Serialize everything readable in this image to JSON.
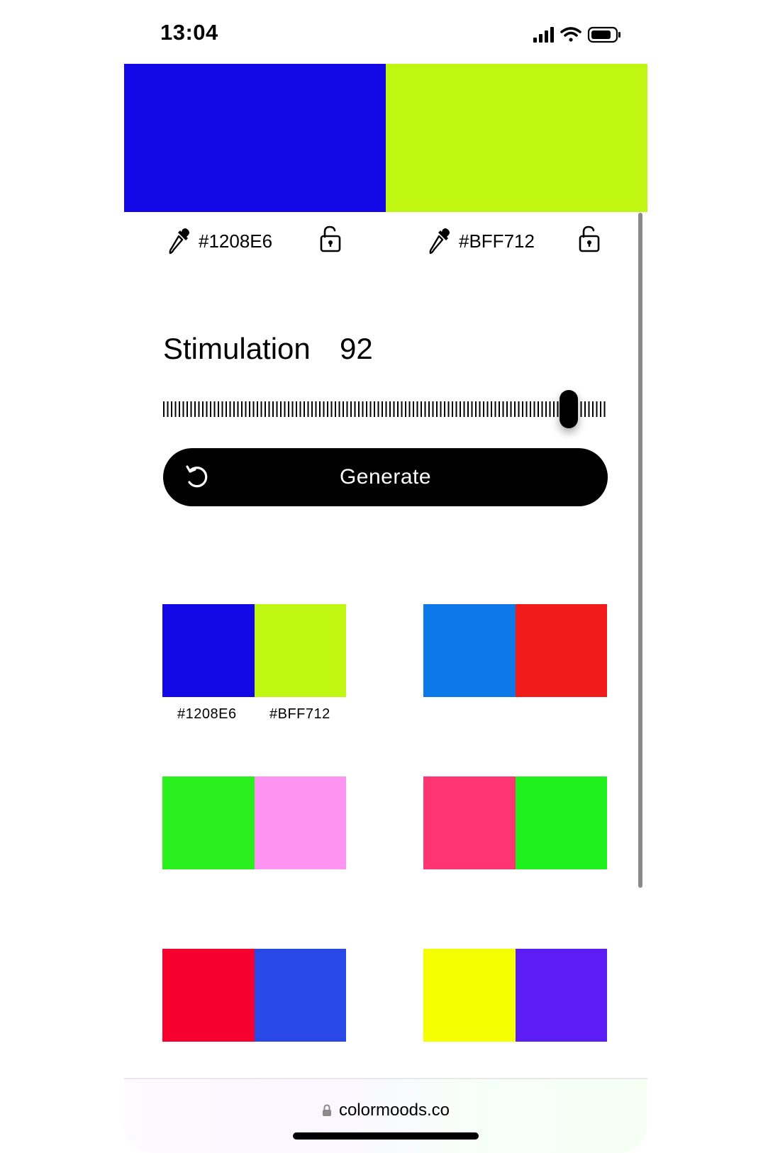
{
  "status_bar": {
    "time": "13:04"
  },
  "hero": {
    "left": {
      "color": "#1208E6",
      "hex": "#1208E6"
    },
    "right": {
      "color": "#BFF712",
      "hex": "#BFF712"
    }
  },
  "stimulation": {
    "label": "Stimulation",
    "value": "92",
    "slider_fraction": 0.92
  },
  "generate_button": {
    "label": "Generate"
  },
  "palettes": [
    {
      "colors": [
        "#1208E6",
        "#BFF712"
      ],
      "labels": [
        "#1208E6",
        "#BFF712"
      ]
    },
    {
      "colors": [
        "#0D79E8",
        "#F21B1B"
      ]
    },
    {
      "colors": [
        "#2AF01E",
        "#FD94F2"
      ]
    },
    {
      "colors": [
        "#FF3572",
        "#1FF11F"
      ]
    },
    {
      "colors": [
        "#F5002F",
        "#2849E5"
      ]
    },
    {
      "colors": [
        "#F5FF00",
        "#5B1DF3"
      ]
    }
  ],
  "browser": {
    "url": "colormoods.co"
  }
}
